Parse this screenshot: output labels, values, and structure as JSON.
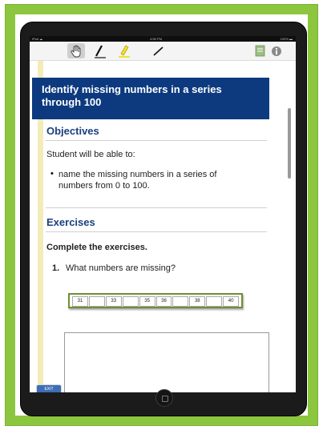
{
  "statusbar": {
    "carrier": "iPad ☁",
    "time": "4:56 PM",
    "battery": "100% ▬"
  },
  "toolbar": {
    "tools": [
      "hand-tool",
      "pen-tool",
      "highlighter-tool",
      "line-tool"
    ],
    "right_icons": [
      "notes-icon",
      "info-icon"
    ]
  },
  "lesson": {
    "title": "Identify missing numbers in a series through 100"
  },
  "objectives": {
    "heading": "Objectives",
    "intro": "Student will be able to:",
    "bullets": [
      "name the missing numbers in a series of numbers from 0 to 100."
    ]
  },
  "exercises": {
    "heading": "Exercises",
    "instruction": "Complete the exercises.",
    "question_number": "1.",
    "question": "What numbers are missing?",
    "series": [
      "31",
      "",
      "33",
      "",
      "35",
      "36",
      "",
      "38",
      "",
      "40"
    ]
  },
  "exit_label": "EXIT",
  "colors": {
    "frame": "#8cc63f",
    "title_bg": "#0d3a7f",
    "heading": "#1a3f7f",
    "margin": "#f3ecb8"
  }
}
